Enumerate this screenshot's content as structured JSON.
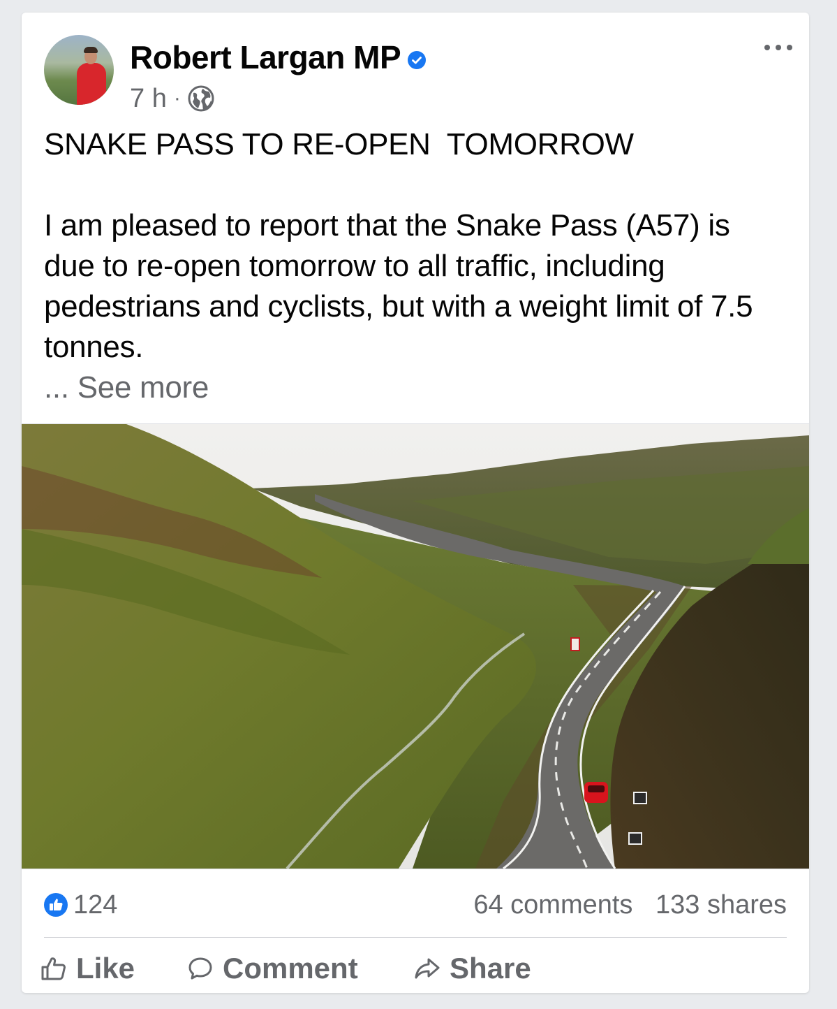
{
  "post": {
    "author": "Robert Largan MP",
    "verified": true,
    "timestamp": "7 h",
    "audience_icon": "globe-icon",
    "headline": "SNAKE PASS TO RE-OPEN  TOMORROW",
    "body": "I am pleased to report that the Snake Pass (A57) is due to re-open tomorrow to all traffic, including pedestrians and cyclists, but with a weight limit of 7.5 tonnes.",
    "see_more": "... See more"
  },
  "stats": {
    "reaction_count": "124",
    "comments": "64 comments",
    "shares": "133 shares"
  },
  "actions": {
    "like": "Like",
    "comment": "Comment",
    "share": "Share"
  },
  "colors": {
    "accent": "#1877f2",
    "secondary_text": "#65676b",
    "primary_text": "#050505"
  }
}
